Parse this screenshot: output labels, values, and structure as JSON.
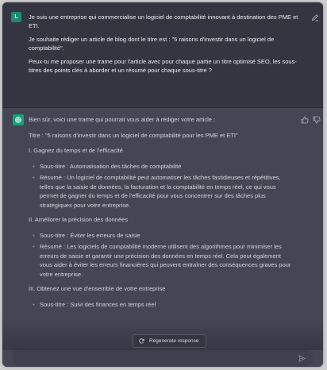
{
  "user_message": {
    "avatar_letter": "L",
    "paragraphs": [
      "Je suis une entreprise qui commercialise un logiciel de comptabilité innovant à destination des PME et ETI.",
      "Je souhaite rédiger un article de blog dont le titre est : \"5 raisons d'investir dans un logiciel de comptabilité\".",
      "Peux-tu me proposer une trame pour l'article avec pour chaque partie un titre optimisé SEO, les sous-titres des points clés à aborder et un résumé pour chaque sous-titre ?"
    ]
  },
  "assistant_message": {
    "intro": "Bien sûr, voici une trame qui pourrait vous aider à rédiger votre article :",
    "title_line": "Titre : \"5 raisons d'investir dans un logiciel de comptabilité pour les PME et ETI\"",
    "section1": {
      "heading": "I. Gagnez du temps et de l'efficacité",
      "subtitle": "Sous-titre : Automatisation des tâches de comptabilité",
      "summary": "Résumé : Un logiciel de comptabilité peut automatiser les tâches fastidieuses et répétitives, telles que la saisie de données, la facturation et la comptabilité en temps réel, ce qui vous permet de gagner du temps et de l'efficacité pour vous concentrer sur des tâches plus stratégiques pour votre entreprise."
    },
    "section2": {
      "heading": "II. Améliorer la précision des données",
      "subtitle": "Sous-titre : Éviter les erreurs de saisie",
      "summary": "Résumé : Les logiciels de comptabilité moderne utilisent des algorithmes pour minimiser les erreurs de saisie et garantir une précision des données en temps réel. Cela peut également vous aider à éviter les erreurs financières qui peuvent entraîner des conséquences graves pour votre entreprise."
    },
    "section3": {
      "heading": "III. Obtenez une vue d'ensemble de votre entreprise",
      "subtitle": "Sous-titre : Suivi des finances en temps réel"
    }
  },
  "regenerate_label": "Regenerate response",
  "colors": {
    "user_bg": "#343541",
    "assistant_bg": "#444654",
    "accent": "#10a37f"
  }
}
